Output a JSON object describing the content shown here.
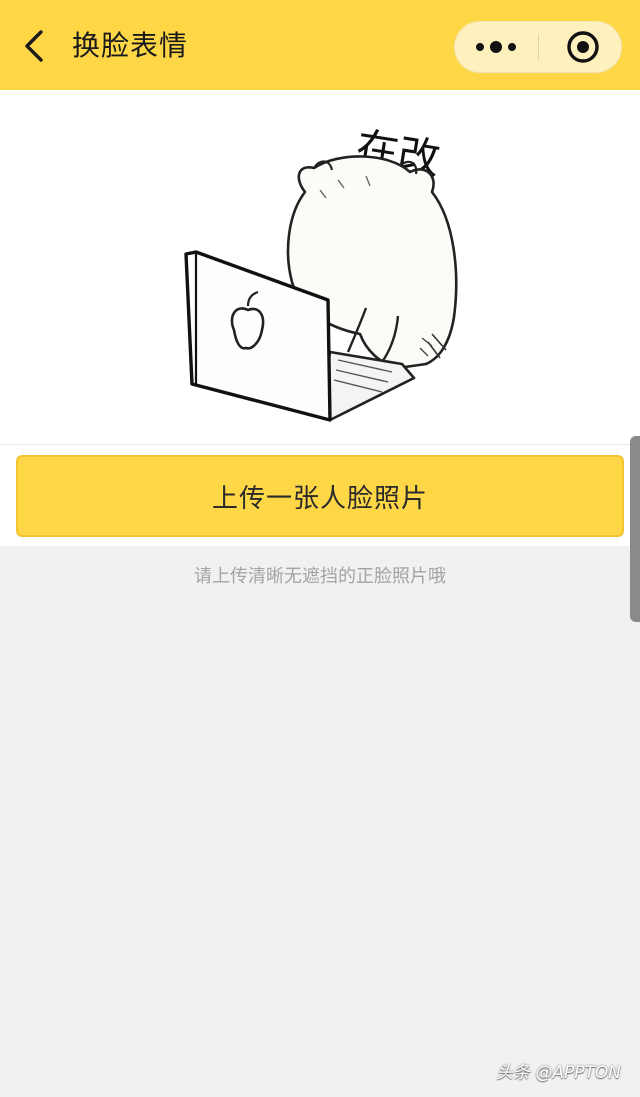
{
  "navbar": {
    "title": "换脸表情",
    "background": "#fed747",
    "back_icon": "chevron-left-icon",
    "capsule": {
      "more_icon": "more-dots-icon",
      "close_icon": "target-circle-icon"
    }
  },
  "sticker": {
    "caption": "在改",
    "icon": "bear-with-laptop-sticker"
  },
  "upload": {
    "button_label": "上传一张人脸照片",
    "button_color": "#fed747",
    "hint": "请上传清晰无遮挡的正脸照片哦"
  },
  "watermark": {
    "text": "头条 @APPTON"
  }
}
